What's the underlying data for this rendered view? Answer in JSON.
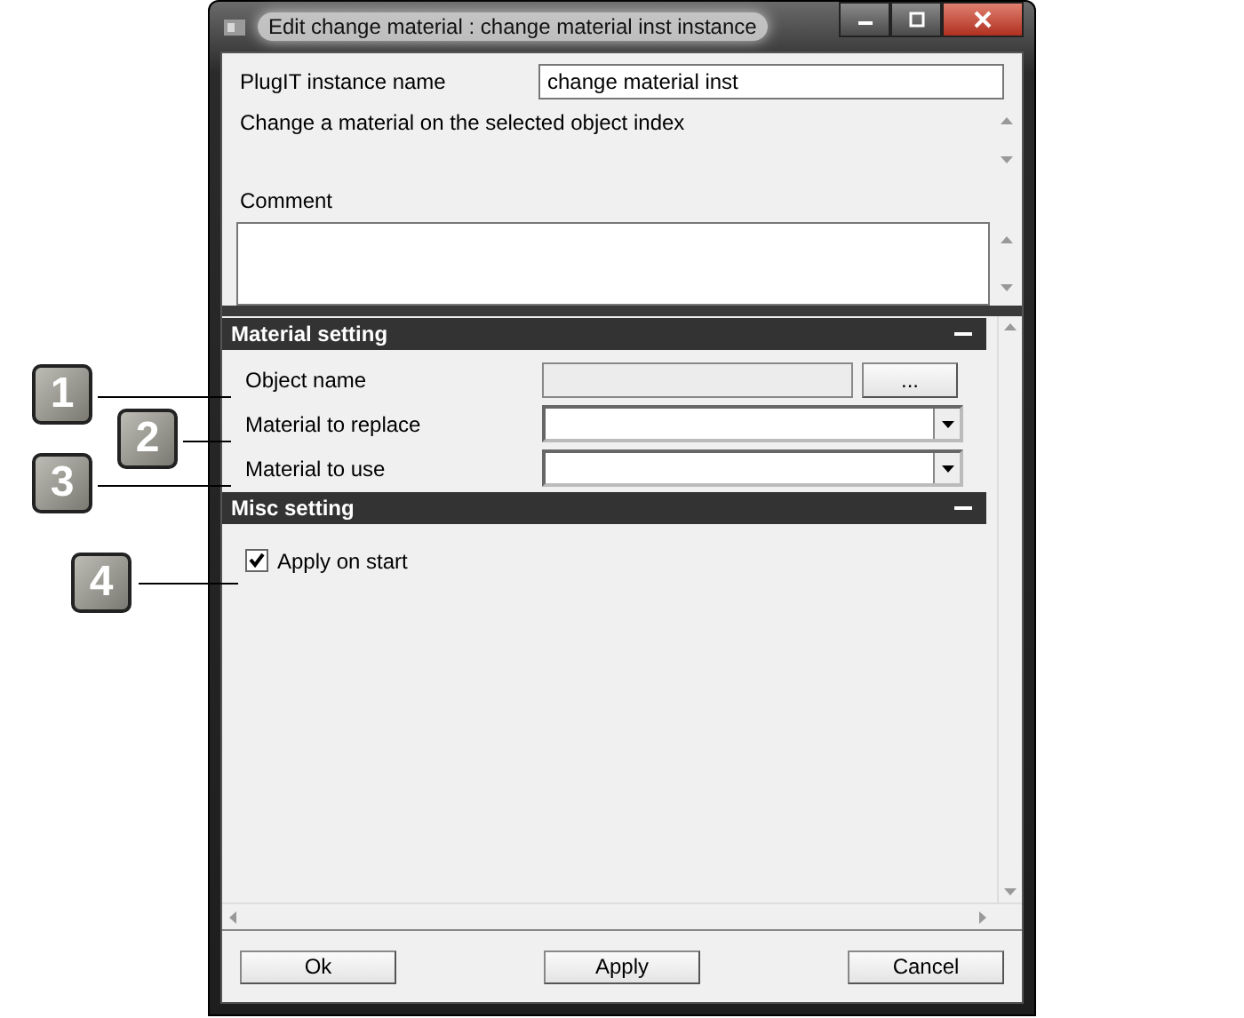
{
  "window": {
    "title": "Edit change material : change material inst instance"
  },
  "instance_name": {
    "label": "PlugIT instance name",
    "value": "change material inst"
  },
  "description": "Change a material on the selected object index",
  "comment": {
    "label": "Comment"
  },
  "sections": [
    {
      "title": "Material setting",
      "fields": [
        {
          "kind": "browse",
          "label": "Object name",
          "button": "..."
        },
        {
          "kind": "dropdown",
          "label": "Material to replace"
        },
        {
          "kind": "dropdown",
          "label": "Material to use"
        }
      ]
    },
    {
      "title": "Misc setting",
      "fields": [
        {
          "kind": "checkbox",
          "label": "Apply on start",
          "checked": true
        }
      ]
    }
  ],
  "buttons": [
    "Ok",
    "Apply",
    "Cancel"
  ],
  "callouts": [
    "1",
    "2",
    "3",
    "4"
  ]
}
